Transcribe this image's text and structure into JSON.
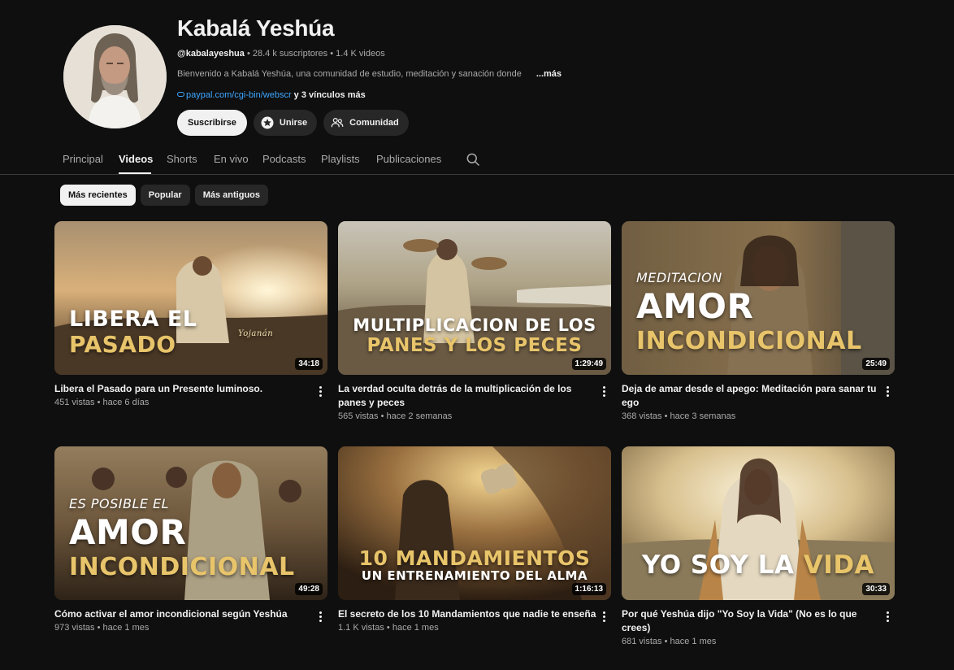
{
  "channel": {
    "name": "Kabalá Yeshúa",
    "handle": "@kabalayeshua",
    "separator": " • ",
    "subscribers": "28.4 k suscriptores",
    "videos_count": "1.4 K videos",
    "description": "Bienvenido a Kabalá Yeshúa, una comunidad de estudio, meditación y sanación donde",
    "more_label": "...más",
    "link_url": "paypal.com/cgi-bin/webscr",
    "more_links": " y 3 vínculos más"
  },
  "actions": {
    "subscribe": "Suscribirse",
    "join": "Unirse",
    "community": "Comunidad"
  },
  "tabs": [
    {
      "label": "Principal"
    },
    {
      "label": "Videos"
    },
    {
      "label": "Shorts"
    },
    {
      "label": "En vivo"
    },
    {
      "label": "Podcasts"
    },
    {
      "label": "Playlists"
    },
    {
      "label": "Publicaciones"
    }
  ],
  "chips": [
    {
      "label": "Más recientes"
    },
    {
      "label": "Popular"
    },
    {
      "label": "Más antiguos"
    }
  ],
  "videos": [
    {
      "title": "Libera el Pasado para un Presente luminoso.",
      "views": "451 vistas",
      "age": "hace 6 días",
      "duration": "34:18",
      "thumb_line1": "LIBERA EL",
      "thumb_line2": "PASADO",
      "thumb_signature": "Yojanán"
    },
    {
      "title": "La verdad oculta detrás de la multiplicación de los panes y peces",
      "views": "565 vistas",
      "age": "hace 2 semanas",
      "duration": "1:29:49",
      "thumb_line1": "MULTIPLICACION DE LOS",
      "thumb_line2": "PANES Y LOS PECES"
    },
    {
      "title": "Deja de amar desde el apego: Meditación para sanar tu ego",
      "views": "368 vistas",
      "age": "hace 3 semanas",
      "duration": "25:49",
      "thumb_line0": "MEDITACION",
      "thumb_line1": "AMOR",
      "thumb_line2": "INCONDICIONAL"
    },
    {
      "title": "Cómo activar el amor incondicional según Yeshúa",
      "views": "973 vistas",
      "age": "hace 1 mes",
      "duration": "49:28",
      "thumb_line0": "ES POSIBLE EL",
      "thumb_line1": "AMOR",
      "thumb_line2": "INCONDICIONAL"
    },
    {
      "title": "El secreto de los 10 Mandamientos que nadie te enseña",
      "views": "1.1 K vistas",
      "age": "hace 1 mes",
      "duration": "1:16:13",
      "thumb_line1": "10 MANDAMIENTOS",
      "thumb_line2": "UN ENTRENAMIENTO DEL ALMA"
    },
    {
      "title": "Por qué Yeshúa dijo \"Yo Soy la Vida\" (No es lo que crees)",
      "views": "681 vistas",
      "age": "hace 1 mes",
      "duration": "30:33",
      "thumb_line1": "YO SOY LA",
      "thumb_line2": "VIDA"
    }
  ],
  "colors": {
    "background": "#0f0f0f",
    "link": "#3ea6ff",
    "thumb_gold": "#e8c46a",
    "thumb_white": "#ffffff"
  },
  "icons": {
    "join": "star-badge-icon",
    "community": "people-icon",
    "search": "search-icon",
    "link": "link-icon",
    "more": "more-vert-icon"
  }
}
